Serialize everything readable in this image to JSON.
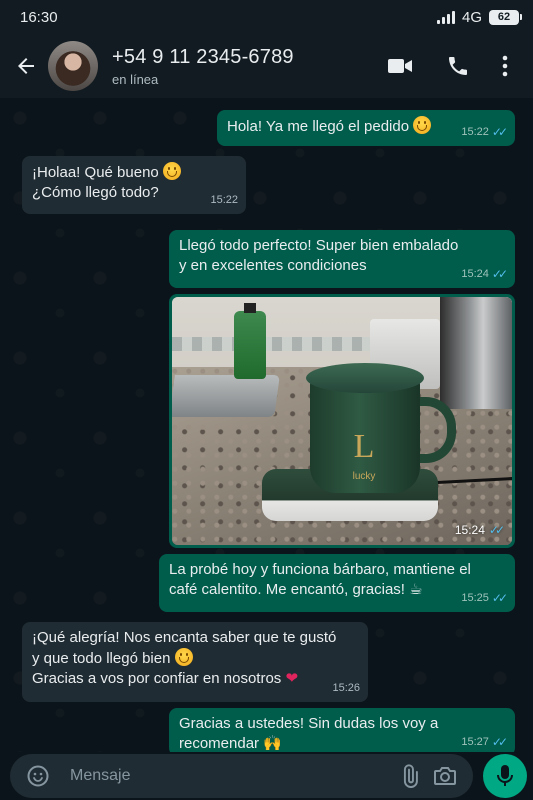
{
  "status_bar": {
    "time": "16:30",
    "network": "4G",
    "battery": "62"
  },
  "header": {
    "contact_name": "+54 9 11 2345-6789",
    "contact_status": "en línea"
  },
  "messages": [
    {
      "dir": "out",
      "text": "Hola! Ya me llegó el pedido",
      "time": "15:22"
    },
    {
      "dir": "in",
      "line1": "¡Holaa! Qué bueno",
      "line2": "¿Cómo llegó todo?",
      "time": "15:22"
    },
    {
      "dir": "out",
      "line1": "Llegó todo perfecto! Super bien embalado",
      "line2": "y en excelentes condiciones",
      "time": "15:24"
    },
    {
      "dir": "out",
      "type": "image",
      "logo_letter": "L",
      "logo_text": "lucky",
      "time": "15:24"
    },
    {
      "dir": "out",
      "line1": "La probé hoy y funciona bárbaro, mantiene el",
      "line2": "café calentito. Me encantó, gracias!",
      "time": "15:25"
    },
    {
      "dir": "in",
      "line1": "¡Qué alegría! Nos encanta saber que te gustó",
      "line2": "y que todo llegó bien",
      "line3": "Gracias a vos por confiar en nosotros",
      "time": "15:26"
    },
    {
      "dir": "out",
      "line1": "Gracias a ustedes! Sin dudas los voy a",
      "line2": "recomendar",
      "time": "15:27"
    }
  ],
  "composer": {
    "placeholder": "Mensaje"
  },
  "colors": {
    "background": "#0b141a",
    "header": "#111b21",
    "outgoing_bubble": "#005c4b",
    "incoming_bubble": "#202c33",
    "read_ticks": "#53bdeb",
    "mic_button": "#00a884"
  },
  "icons": {
    "back": "arrow-left-icon",
    "video": "video-camera-icon",
    "call": "phone-icon",
    "menu": "more-vertical-icon",
    "emoji": "emoji-icon",
    "attach": "paperclip-icon",
    "camera": "camera-icon",
    "mic": "microphone-icon"
  }
}
